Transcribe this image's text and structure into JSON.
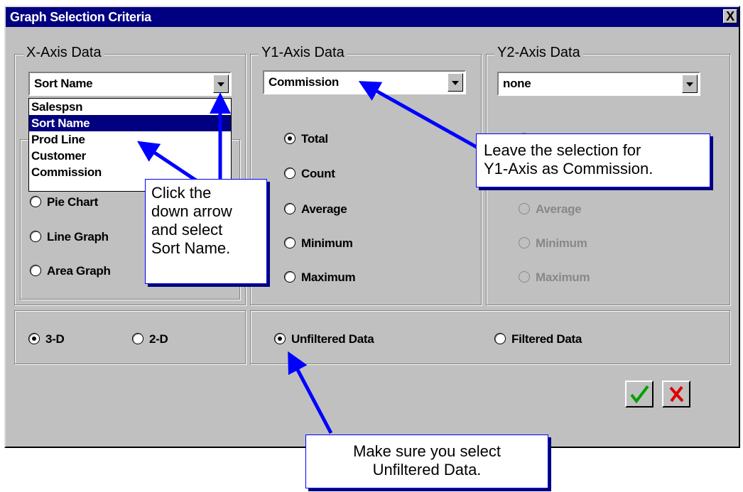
{
  "dialog": {
    "title": "Graph Selection Criteria",
    "close_glyph": "X"
  },
  "x_axis": {
    "label": "X-Axis Data",
    "selected": "Sort Name",
    "options": [
      "Salespsn",
      "Sort Name",
      "Prod Line",
      "Customer",
      "Commission"
    ],
    "graph_types": [
      "Pie Chart",
      "Line Graph",
      "Area Graph"
    ]
  },
  "y1_axis": {
    "label": "Y1-Axis Data",
    "selected": "Commission",
    "options": [
      "Total",
      "Count",
      "Average",
      "Minimum",
      "Maximum"
    ],
    "checked": "Total"
  },
  "y2_axis": {
    "label": "Y2-Axis Data",
    "selected": "none",
    "options": [
      "Average",
      "Minimum",
      "Maximum"
    ]
  },
  "dimension": {
    "options": [
      "3-D",
      "2-D"
    ],
    "checked": "3-D"
  },
  "filter": {
    "options": [
      "Unfiltered Data",
      "Filtered Data"
    ],
    "checked": "Unfiltered Data"
  },
  "buttons": {
    "ok_icon": "checkmark-icon",
    "cancel_icon": "x-icon"
  },
  "callouts": {
    "dropdown": [
      "Click the",
      "down arrow",
      "and select",
      "Sort Name."
    ],
    "y1": [
      "Leave the selection for",
      "Y1-Axis as Commission."
    ],
    "filter": [
      "Make sure you select",
      "Unfiltered Data."
    ]
  },
  "colors": {
    "titlebar": "#000080",
    "dialog_bg": "#c0c0c0",
    "callout_border": "#0000ff",
    "arrow": "#0000ff",
    "ok_check": "#00a000",
    "cancel_x": "#e00000"
  }
}
